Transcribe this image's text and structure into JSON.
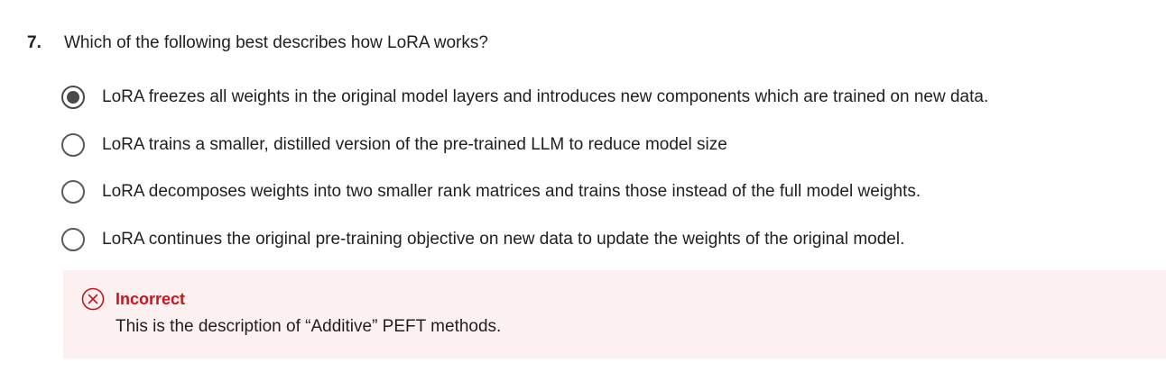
{
  "question": {
    "number": "7.",
    "text": "Which of the following best describes how LoRA works?",
    "options": [
      {
        "label": "LoRA freezes all weights in the original model layers and introduces new components which are trained on new data.",
        "selected": true
      },
      {
        "label": "LoRA trains  a smaller, distilled version of the pre-trained LLM to reduce model size",
        "selected": false
      },
      {
        "label": "LoRA decomposes weights into two smaller rank matrices and trains those instead of the full model weights.",
        "selected": false
      },
      {
        "label": "LoRA continues the original pre-training objective on new data to update the weights of the original model.",
        "selected": false
      }
    ]
  },
  "feedback": {
    "status": "Incorrect",
    "icon": "x-circle-icon",
    "message": "This is the description of “Additive” PEFT methods.",
    "colors": {
      "status": "#c4161c",
      "background": "#fdf0f0"
    }
  }
}
